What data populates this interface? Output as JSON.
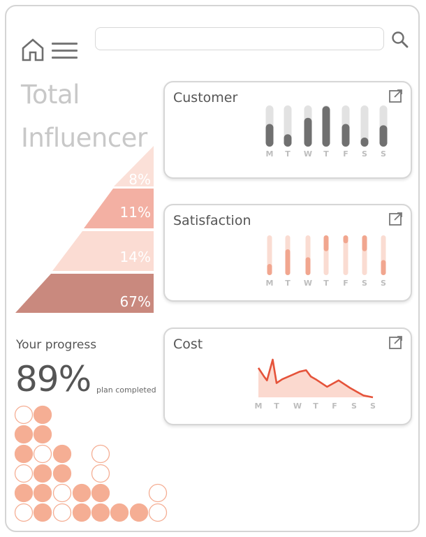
{
  "header": {
    "home_icon": "home-icon",
    "menu_icon": "hamburger-menu-icon",
    "search": {
      "value": "",
      "placeholder": ""
    },
    "search_icon": "search-icon"
  },
  "title": {
    "line1": "Total",
    "line2": "Influencer"
  },
  "pyramid": {
    "tiers": [
      {
        "label": "8%",
        "color": "#fbe0d8"
      },
      {
        "label": "11%",
        "color": "#f3b0a3"
      },
      {
        "label": "14%",
        "color": "#fbdcd3"
      },
      {
        "label": "67%",
        "color": "#c9897e"
      }
    ]
  },
  "progress": {
    "label": "Your progress",
    "value": "89%",
    "caption": "plan completed",
    "filled_color": "#f5ae94",
    "outline_color": "#f5ae94"
  },
  "cards": {
    "customer": {
      "title": "Customer",
      "open_icon": "external-link-icon",
      "chart_data": {
        "type": "bar",
        "categories": [
          "M",
          "T",
          "W",
          "T",
          "F",
          "S",
          "S"
        ],
        "values": [
          0.55,
          0.3,
          0.7,
          0.98,
          0.55,
          0.22,
          0.52
        ],
        "ylim": [
          0,
          1
        ],
        "colors": {
          "fill": "#707070",
          "track": "#e2e2e2"
        }
      }
    },
    "satisfaction": {
      "title": "Satisfaction",
      "open_icon": "external-link-icon",
      "chart_data": {
        "type": "bar",
        "categories": [
          "M",
          "T",
          "W",
          "T",
          "F",
          "S",
          "S"
        ],
        "ranges": [
          [
            0,
            0.28
          ],
          [
            0,
            0.65
          ],
          [
            0,
            0.45
          ],
          [
            0.6,
            1
          ],
          [
            0.8,
            1
          ],
          [
            0.6,
            1
          ],
          [
            0,
            0.38
          ]
        ],
        "ylim": [
          0,
          1
        ],
        "colors": {
          "fill": "#f1a68f",
          "track": "#fadcd2"
        }
      }
    },
    "cost": {
      "title": "Cost",
      "open_icon": "external-link-icon",
      "chart_data": {
        "type": "area",
        "categories": [
          "M",
          "T",
          "W",
          "T",
          "F",
          "S",
          "S"
        ],
        "x": [
          0,
          0.3,
          0.45,
          0.75,
          0.95,
          1.25,
          1.8,
          2.15,
          2.5,
          2.75,
          3.0,
          3.6,
          4.2,
          4.8,
          5.5,
          6.0
        ],
        "y": [
          0.78,
          0.55,
          0.45,
          1.0,
          0.38,
          0.48,
          0.6,
          0.68,
          0.72,
          0.55,
          0.48,
          0.28,
          0.45,
          0.25,
          0.05,
          0.0
        ],
        "ylim": [
          0,
          1
        ],
        "colors": {
          "line": "#e5533a",
          "fill": "#fbd9cf"
        }
      }
    }
  }
}
